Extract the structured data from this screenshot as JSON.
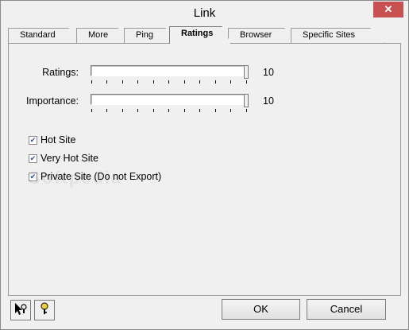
{
  "window": {
    "title": "Link",
    "close_glyph": "✕"
  },
  "tabs": [
    {
      "label": "Standard",
      "active": false
    },
    {
      "label": "More",
      "active": false
    },
    {
      "label": "Ping",
      "active": false
    },
    {
      "label": "Ratings",
      "active": true
    },
    {
      "label": "Browser",
      "active": false
    },
    {
      "label": "Specific Sites",
      "active": false
    }
  ],
  "ratings": {
    "label": "Ratings:",
    "value": "10",
    "level": 1.0
  },
  "importance": {
    "label": "Importance:",
    "value": "10",
    "level": 1.0
  },
  "checkboxes": [
    {
      "label": "Hot Site",
      "checked": true
    },
    {
      "label": "Very Hot Site",
      "checked": true
    },
    {
      "label": "Private Site (Do not Export)",
      "checked": true
    }
  ],
  "watermark": "Softpedia",
  "buttons": {
    "ok": "OK",
    "cancel": "Cancel"
  },
  "icons": {
    "whats_this": "pointer-help-icon",
    "help": "question-icon"
  }
}
